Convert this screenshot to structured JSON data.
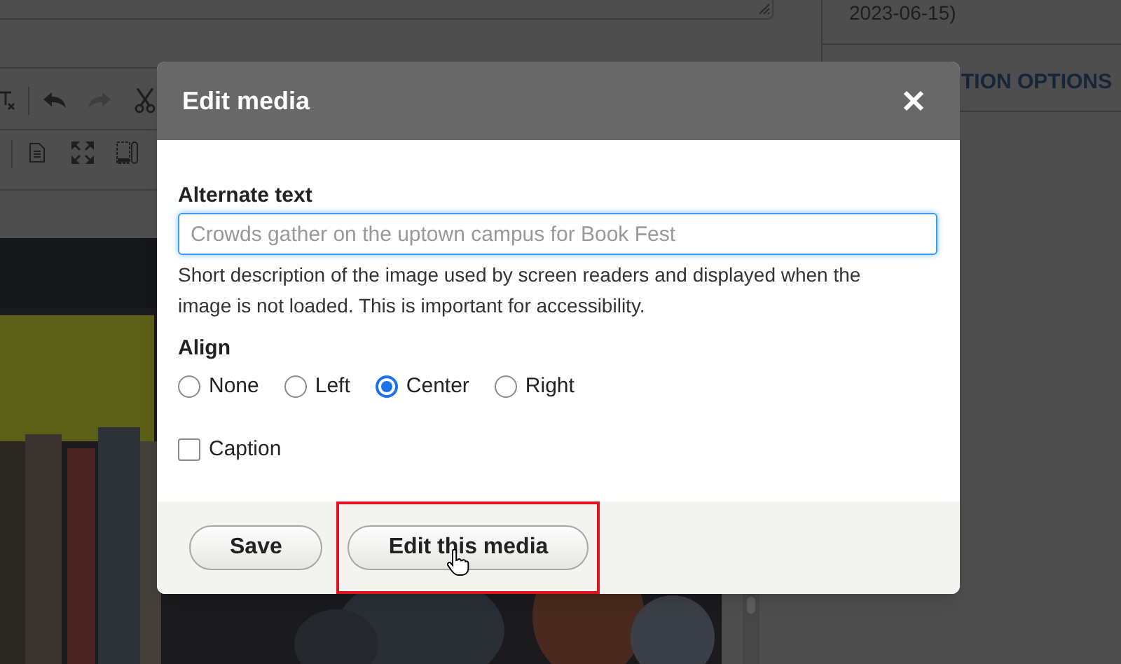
{
  "background": {
    "date_text": "2023-06-15)",
    "section_heading": "TION OPTIONS"
  },
  "dialog": {
    "title": "Edit media",
    "alt_text": {
      "label": "Alternate text",
      "placeholder": "Crowds gather on the uptown campus for Book Fest",
      "description": "Short description of the image used by screen readers and displayed when the image is not loaded. This is important for accessibility."
    },
    "align": {
      "label": "Align",
      "options": [
        {
          "label": "None",
          "selected": false
        },
        {
          "label": "Left",
          "selected": false
        },
        {
          "label": "Center",
          "selected": true
        },
        {
          "label": "Right",
          "selected": false
        }
      ]
    },
    "caption": {
      "label": "Caption",
      "checked": false
    },
    "buttons": [
      {
        "label": "Save",
        "highlighted": false
      },
      {
        "label": "Edit this media",
        "highlighted": true
      }
    ]
  }
}
